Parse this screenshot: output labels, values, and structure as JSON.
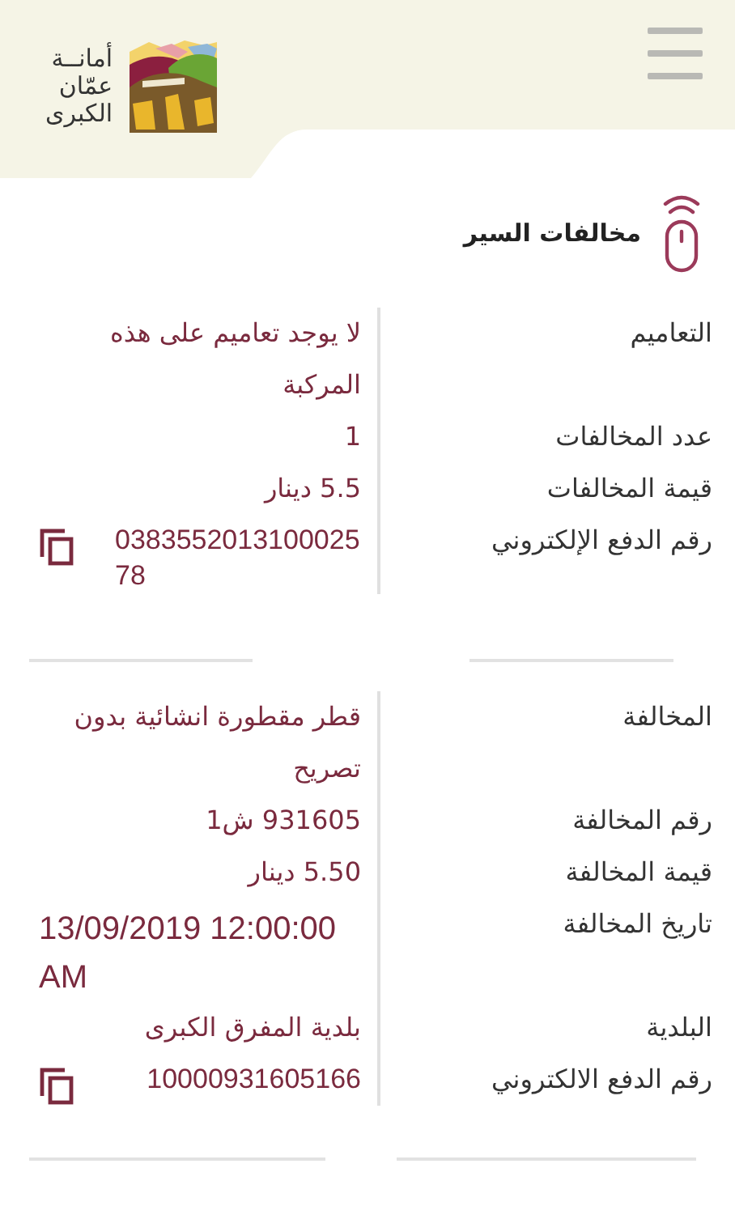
{
  "header": {
    "logo_lines": [
      "أمانــة",
      "عمّان",
      "الكبرى"
    ]
  },
  "title": "مخالفات السير",
  "sections": [
    {
      "rows": [
        {
          "kind": "text",
          "label": "التعاميم",
          "value": "لا يوجد تعاميم على هذه المركبة"
        },
        {
          "kind": "text",
          "label": "عدد المخالفات",
          "value": "1"
        },
        {
          "kind": "text",
          "label": "قيمة المخالفات",
          "value": "5.5 دينار"
        },
        {
          "kind": "copy",
          "label": "رقم الدفع الإلكتروني",
          "value": "038355201310002578"
        }
      ]
    },
    {
      "rows": [
        {
          "kind": "text",
          "label": "المخالفة",
          "value": "قطر مقطورة انشائية بدون تصريح"
        },
        {
          "kind": "text",
          "label": "رقم المخالفة",
          "value": "931605 ش1"
        },
        {
          "kind": "text",
          "label": "قيمة المخالفة",
          "value": "5.50 دينار"
        },
        {
          "kind": "date",
          "label": "تاريخ المخالفة",
          "value": "13/09/2019 12:00:00 AM"
        },
        {
          "kind": "text",
          "label": "البلدية",
          "value": "بلدية المفرق الكبرى"
        },
        {
          "kind": "copy",
          "label": "رقم الدفع الالكتروني",
          "value": "10000931605166"
        }
      ]
    }
  ]
}
